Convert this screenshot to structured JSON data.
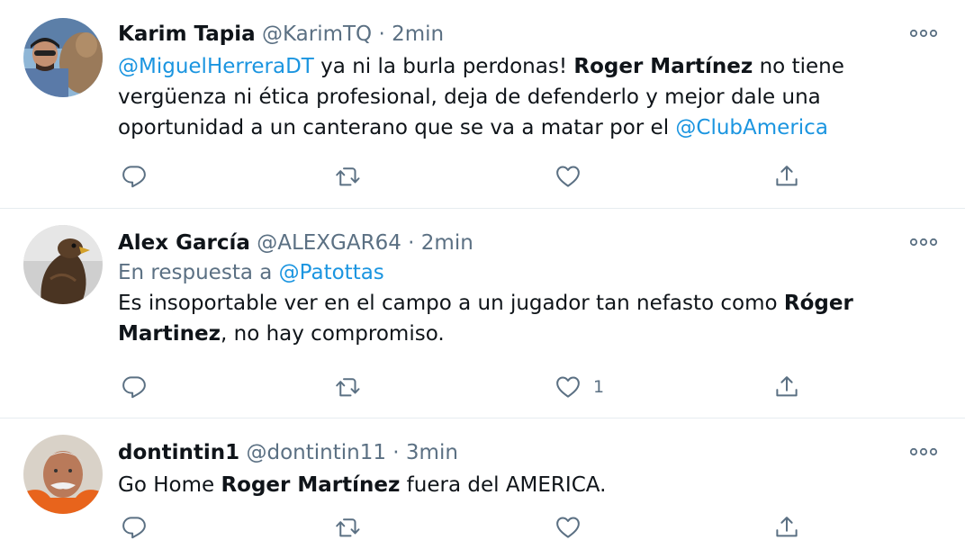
{
  "tweets": [
    {
      "name": "Karim Tapia",
      "handle": "@KarimTQ",
      "sep": "·",
      "time": "2min",
      "text": {
        "m1": "@MiguelHerreraDT",
        "p1": " ya ni la burla perdonas! ",
        "b1": "Roger Martínez",
        "p2": " no tiene vergüenza ni ética profesional, deja de defenderlo y mejor dale una oportunidad a un canterano que se va a matar por el ",
        "m2": "@ClubAmerica"
      },
      "like_count": ""
    },
    {
      "name": "Alex García",
      "handle": "@ALEXGAR64",
      "sep": "·",
      "time": "2min",
      "reply_prefix": "En respuesta a ",
      "reply_to": "@Patottas",
      "text": {
        "p1": "Es insoportable ver en el campo a un jugador tan nefasto como ",
        "b1": "Róger Martinez",
        "p2": ", no hay compromiso."
      },
      "like_count": "1"
    },
    {
      "name": "dontintin1",
      "handle": "@dontintin11",
      "sep": "·",
      "time": "3min",
      "text": {
        "p1": "Go Home ",
        "b1": "Roger Martínez",
        "p2": " fuera del AMERICA."
      },
      "like_count": ""
    }
  ],
  "icons": {
    "more": "more-horizontal-icon",
    "reply": "reply-icon",
    "retweet": "retweet-icon",
    "like": "heart-icon",
    "share": "share-icon"
  },
  "colors": {
    "mention": "#1b95e0",
    "secondary": "#5b7083",
    "border": "#e6ecf0"
  }
}
